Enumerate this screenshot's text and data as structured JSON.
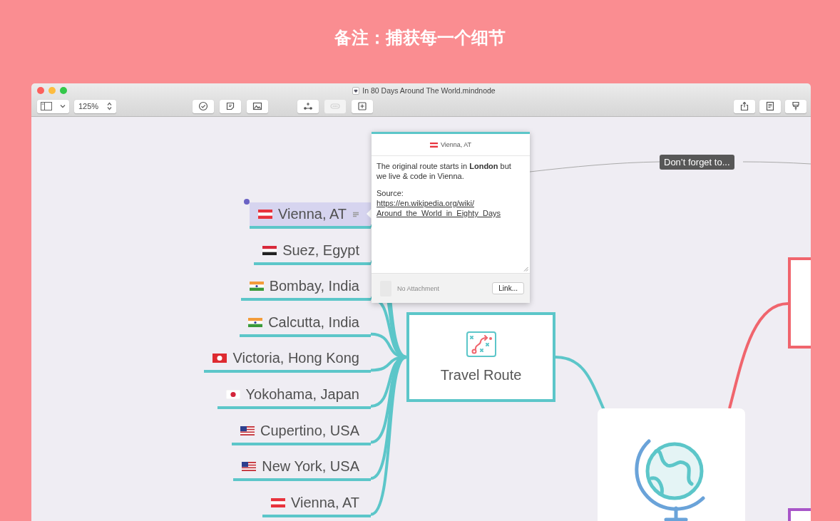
{
  "heading": "备注：捕获每一个细节",
  "window": {
    "title": "In 80 Days Around The World.mindnode"
  },
  "toolbar": {
    "zoom": "125%",
    "buttons": [
      {
        "kind": "check",
        "disabled": false
      },
      {
        "kind": "note",
        "disabled": false
      },
      {
        "kind": "image",
        "disabled": false
      },
      {
        "kind": "child",
        "disabled": false
      },
      {
        "kind": "connect",
        "disabled": true
      },
      {
        "kind": "add",
        "disabled": false
      },
      {
        "kind": "share",
        "disabled": false
      },
      {
        "kind": "notes",
        "disabled": false
      },
      {
        "kind": "style",
        "disabled": false
      }
    ]
  },
  "nodes": [
    {
      "label": "Vienna, AT",
      "kind": "austria",
      "selected": true,
      "has_note": true
    },
    {
      "label": "Suez, Egypt",
      "kind": "egypt",
      "selected": false,
      "has_note": false
    },
    {
      "label": "Bombay, India",
      "kind": "india",
      "selected": false,
      "has_note": false
    },
    {
      "label": "Calcutta, India",
      "kind": "india",
      "selected": false,
      "has_note": false
    },
    {
      "label": "Victoria, Hong Kong",
      "kind": "hongkong",
      "selected": false,
      "has_note": false
    },
    {
      "label": "Yokohama, Japan",
      "kind": "japan",
      "selected": false,
      "has_note": false
    },
    {
      "label": "Cupertino, USA",
      "kind": "usa",
      "selected": false,
      "has_note": false
    },
    {
      "label": "New York, USA",
      "kind": "usa",
      "selected": false,
      "has_note": false
    },
    {
      "label": "Vienna, AT",
      "kind": "austria",
      "selected": false,
      "has_note": false
    }
  ],
  "travel_route": {
    "label": "Travel Route"
  },
  "connection_label": "Don’t forget to...",
  "note_popup": {
    "title": "Vienna, AT",
    "kind": "austria",
    "text": "The original route starts in **London** but we live & code in Vienna.",
    "source_label": "Source:",
    "link": "https://en.wikipedia.org/wiki/Around_the_World_in_Eighty_Days",
    "attachment": "No Attachment",
    "link_button": "Link..."
  }
}
